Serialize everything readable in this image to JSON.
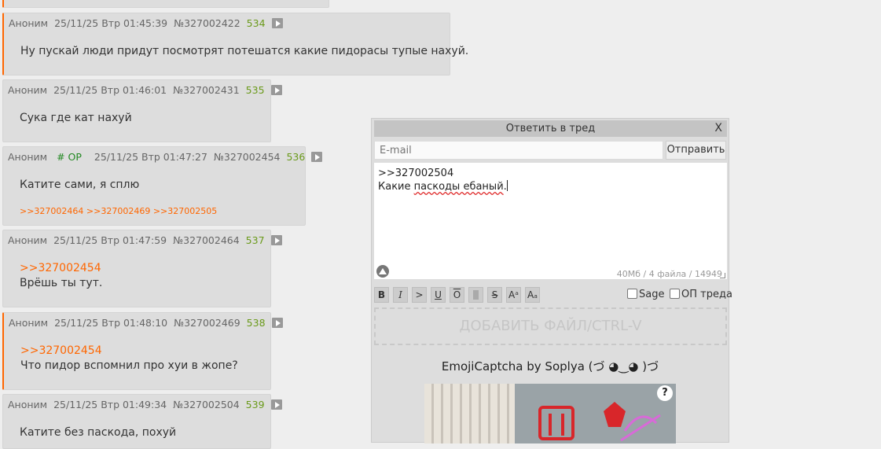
{
  "posts": [
    {
      "author": "Аноним",
      "date": "25/11/25 Втр 01:45:39",
      "id": "№327002422",
      "count": "534",
      "text": "Ну пускай люди придут посмотрят потешатся какие пидорасы тупые нахуй."
    },
    {
      "author": "Аноним",
      "date": "25/11/25 Втр 01:46:01",
      "id": "№327002431",
      "count": "535",
      "text": "Сука где кат нахуй"
    },
    {
      "author": "Аноним",
      "op_tag": "# OP",
      "date": "25/11/25 Втр 01:47:27",
      "id": "№327002454",
      "count": "536",
      "text": "Катите сами, я сплю",
      "replies": ">>327002464 >>327002469 >>327002505"
    },
    {
      "author": "Аноним",
      "date": "25/11/25 Втр 01:47:59",
      "id": "№327002464",
      "count": "537",
      "quote": ">>327002454",
      "text": "Врёшь ты тут."
    },
    {
      "author": "Аноним",
      "date": "25/11/25 Втр 01:48:10",
      "id": "№327002469",
      "count": "538",
      "quote": ">>327002454",
      "text": "Что пидор вспомнил про хуи в жопе?"
    },
    {
      "author": "Аноним",
      "date": "25/11/25 Втр 01:49:34",
      "id": "№327002504",
      "count": "539",
      "text": "Катите без паскода, похуй"
    }
  ],
  "reply_form": {
    "title": "Ответить в тред",
    "close": "X",
    "email_placeholder": "E-mail",
    "send_label": "Отправить",
    "message_line1": ">>327002504",
    "message_line2_pre": "Какие ",
    "message_line2_misspelled": "паскоды ебаный",
    "message_line2_post": ".",
    "limits": "40Мб / 4 файла / 14949",
    "toolbar": {
      "bold": "B",
      "italic": "I",
      "quote": ">",
      "underline": "U",
      "overline": "O",
      "strike": "S",
      "sup": "Aᵃ",
      "sub": "Aₐ"
    },
    "sage_label": "Sage",
    "op_label": "ОП треда",
    "dropzone_label": "ДОБАВИТЬ ФАЙЛ/CTRL-V",
    "captcha_title": "EmojiCaptcha by Soplya (づ ◕‿◕ )づ",
    "captcha_help": "?"
  },
  "colors": {
    "accent": "#ff6600",
    "post_bg": "#dddddd",
    "page_bg": "#eeeeee",
    "post_count": "#6a9a1a",
    "op_tag": "#228822"
  }
}
